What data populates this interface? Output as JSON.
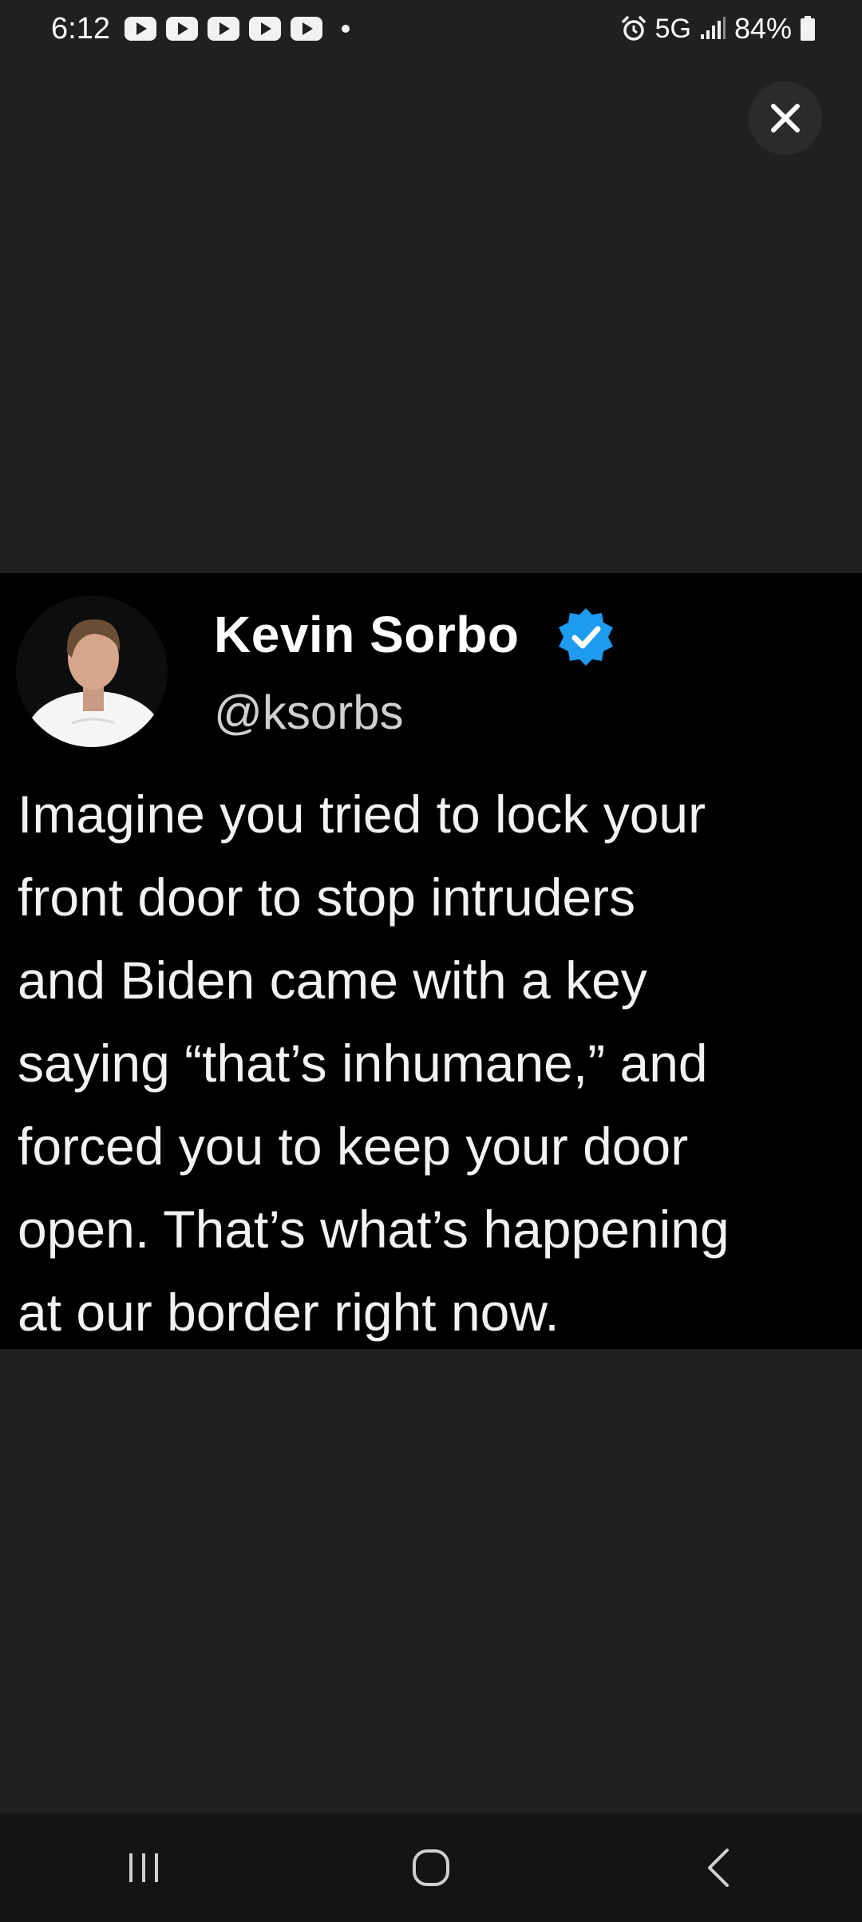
{
  "status_bar": {
    "time": "6:12",
    "notification_icons": [
      "youtube-icon",
      "youtube-icon",
      "youtube-icon",
      "youtube-icon",
      "youtube-icon"
    ],
    "network": "5G",
    "battery": "84%"
  },
  "viewer": {
    "close_icon": "close-icon"
  },
  "tweet": {
    "author_name": "Kevin Sorbo",
    "handle": "@ksorbs",
    "verified_color": "#1d9bf0",
    "text_lines": [
      "Imagine you tried to lock your",
      "front door to stop intruders",
      "and Biden came with a key",
      "saying “that’s inhumane,” and",
      "forced you to keep your door",
      "open. That’s what’s happening",
      "at our border right now."
    ]
  },
  "nav_bar": {
    "recents_icon": "recents-icon",
    "home_icon": "home-icon",
    "back_icon": "back-icon"
  }
}
